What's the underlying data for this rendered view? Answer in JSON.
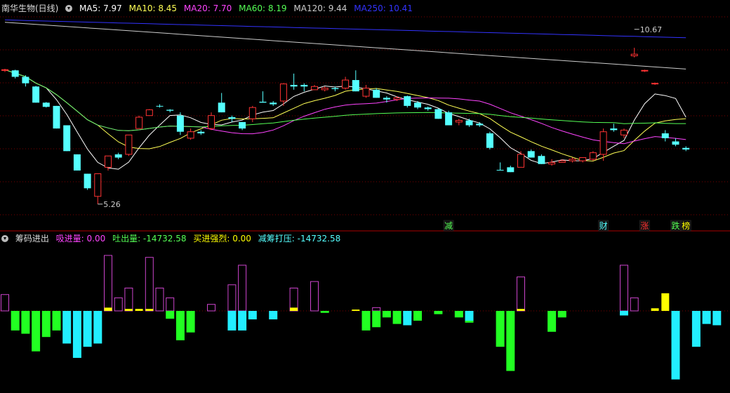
{
  "main_header": {
    "title": "南华生物(日线)",
    "ma": [
      {
        "label": "MA5: 7.97",
        "color": "#ffffff"
      },
      {
        "label": "MA10: 8.45",
        "color": "#ffff55"
      },
      {
        "label": "MA20: 7.70",
        "color": "#ff44ff"
      },
      {
        "label": "MA60: 8.19",
        "color": "#55ff55"
      },
      {
        "label": "MA120: 9.44",
        "color": "#cccccc"
      },
      {
        "label": "MA250: 10.41",
        "color": "#3333ff"
      }
    ]
  },
  "sub_header": {
    "title": "筹码进出",
    "items": [
      {
        "label": "吸进量: 0.00",
        "color": "#ff44ff"
      },
      {
        "label": "吐出量: -14732.58",
        "color": "#55ff55"
      },
      {
        "label": "买进强烈: 0.00",
        "color": "#ffff00"
      },
      {
        "label": "减筹打压: -14732.58",
        "color": "#55ffff"
      }
    ]
  },
  "colors": {
    "up": "#ff3333",
    "down": "#55ffff",
    "grid": "#7a0000",
    "bar_in": "#cc44cc",
    "bar_out": "#22ff22",
    "bar_strong": "#ffff00",
    "bar_press": "#22eeff"
  },
  "chart_data": [
    {
      "type": "candlestick",
      "y_range": [
        4.8,
        11.1
      ],
      "candles": [
        {
          "o": 9.4,
          "h": 9.45,
          "l": 9.35,
          "c": 9.42,
          "d": "up"
        },
        {
          "o": 9.4,
          "h": 9.42,
          "l": 9.15,
          "c": 9.2,
          "d": "down"
        },
        {
          "o": 9.2,
          "h": 9.25,
          "l": 8.9,
          "c": 9.0,
          "d": "down"
        },
        {
          "o": 8.9,
          "h": 8.92,
          "l": 8.4,
          "c": 8.4,
          "d": "down"
        },
        {
          "o": 8.4,
          "h": 8.42,
          "l": 8.25,
          "c": 8.27,
          "d": "down"
        },
        {
          "o": 8.3,
          "h": 8.3,
          "l": 7.6,
          "c": 7.6,
          "d": "down"
        },
        {
          "o": 7.7,
          "h": 7.7,
          "l": 6.9,
          "c": 6.9,
          "d": "down"
        },
        {
          "o": 6.8,
          "h": 6.8,
          "l": 6.3,
          "c": 6.3,
          "d": "down"
        },
        {
          "o": 6.2,
          "h": 6.2,
          "l": 5.7,
          "c": 5.75,
          "d": "down"
        },
        {
          "o": 5.5,
          "h": 6.2,
          "l": 5.26,
          "c": 6.2,
          "d": "up"
        },
        {
          "o": 6.4,
          "h": 6.75,
          "l": 6.3,
          "c": 6.75,
          "d": "up"
        },
        {
          "o": 6.8,
          "h": 6.85,
          "l": 6.65,
          "c": 6.7,
          "d": "down"
        },
        {
          "o": 6.8,
          "h": 7.4,
          "l": 6.75,
          "c": 7.4,
          "d": "up"
        },
        {
          "o": 7.6,
          "h": 8.0,
          "l": 7.6,
          "c": 7.95,
          "d": "up"
        },
        {
          "o": 8.0,
          "h": 8.2,
          "l": 8.0,
          "c": 8.18,
          "d": "up"
        },
        {
          "o": 8.3,
          "h": 8.35,
          "l": 8.25,
          "c": 8.3,
          "d": "down"
        },
        {
          "o": 8.15,
          "h": 8.2,
          "l": 8.1,
          "c": 8.18,
          "d": "down"
        },
        {
          "o": 8.0,
          "h": 8.1,
          "l": 7.4,
          "c": 7.5,
          "d": "down"
        },
        {
          "o": 7.3,
          "h": 7.6,
          "l": 7.25,
          "c": 7.5,
          "d": "up"
        },
        {
          "o": 7.5,
          "h": 7.55,
          "l": 7.4,
          "c": 7.45,
          "d": "down"
        },
        {
          "o": 7.6,
          "h": 8.1,
          "l": 7.55,
          "c": 8.0,
          "d": "up"
        },
        {
          "o": 8.4,
          "h": 8.7,
          "l": 8.1,
          "c": 8.1,
          "d": "down"
        },
        {
          "o": 7.9,
          "h": 8.0,
          "l": 7.8,
          "c": 7.95,
          "d": "down"
        },
        {
          "o": 7.6,
          "h": 7.8,
          "l": 7.55,
          "c": 7.8,
          "d": "down"
        },
        {
          "o": 7.9,
          "h": 8.3,
          "l": 7.8,
          "c": 8.25,
          "d": "up"
        },
        {
          "o": 8.4,
          "h": 8.75,
          "l": 8.4,
          "c": 8.43,
          "d": "down"
        },
        {
          "o": 8.4,
          "h": 8.45,
          "l": 8.3,
          "c": 8.35,
          "d": "down"
        },
        {
          "o": 8.45,
          "h": 9.0,
          "l": 8.3,
          "c": 8.98,
          "d": "up"
        },
        {
          "o": 8.9,
          "h": 9.3,
          "l": 8.8,
          "c": 8.95,
          "d": "down"
        },
        {
          "o": 8.95,
          "h": 9.0,
          "l": 8.75,
          "c": 8.9,
          "d": "down"
        },
        {
          "o": 8.8,
          "h": 8.95,
          "l": 8.8,
          "c": 8.9,
          "d": "up"
        },
        {
          "o": 8.8,
          "h": 8.9,
          "l": 8.75,
          "c": 8.85,
          "d": "up"
        },
        {
          "o": 8.85,
          "h": 8.9,
          "l": 8.75,
          "c": 8.82,
          "d": "down"
        },
        {
          "o": 8.85,
          "h": 9.2,
          "l": 8.8,
          "c": 9.1,
          "d": "up"
        },
        {
          "o": 9.1,
          "h": 9.4,
          "l": 8.75,
          "c": 8.75,
          "d": "down"
        },
        {
          "o": 8.85,
          "h": 8.95,
          "l": 8.55,
          "c": 8.6,
          "d": "up"
        },
        {
          "o": 8.8,
          "h": 8.85,
          "l": 8.55,
          "c": 8.55,
          "d": "down"
        },
        {
          "o": 8.55,
          "h": 8.6,
          "l": 8.4,
          "c": 8.5,
          "d": "down"
        },
        {
          "o": 8.55,
          "h": 8.6,
          "l": 8.45,
          "c": 8.5,
          "d": "up"
        },
        {
          "o": 8.6,
          "h": 8.62,
          "l": 8.25,
          "c": 8.3,
          "d": "down"
        },
        {
          "o": 8.4,
          "h": 8.45,
          "l": 8.2,
          "c": 8.25,
          "d": "down"
        },
        {
          "o": 8.25,
          "h": 8.28,
          "l": 8.15,
          "c": 8.2,
          "d": "down"
        },
        {
          "o": 8.2,
          "h": 8.22,
          "l": 7.9,
          "c": 7.9,
          "d": "down"
        },
        {
          "o": 8.1,
          "h": 8.15,
          "l": 7.7,
          "c": 7.7,
          "d": "down"
        },
        {
          "o": 7.85,
          "h": 7.9,
          "l": 7.7,
          "c": 7.8,
          "d": "up"
        },
        {
          "o": 7.85,
          "h": 7.9,
          "l": 7.65,
          "c": 7.7,
          "d": "down"
        },
        {
          "o": 7.7,
          "h": 7.8,
          "l": 7.65,
          "c": 7.75,
          "d": "down"
        },
        {
          "o": 7.45,
          "h": 7.5,
          "l": 6.95,
          "c": 7.0,
          "d": "down"
        },
        {
          "o": 6.3,
          "h": 6.55,
          "l": 6.3,
          "c": 6.32,
          "d": "down"
        },
        {
          "o": 6.4,
          "h": 6.45,
          "l": 6.25,
          "c": 6.25,
          "d": "down"
        },
        {
          "o": 6.4,
          "h": 6.9,
          "l": 6.4,
          "c": 6.8,
          "d": "up"
        },
        {
          "o": 6.9,
          "h": 6.95,
          "l": 6.7,
          "c": 6.7,
          "d": "down"
        },
        {
          "o": 6.75,
          "h": 6.8,
          "l": 6.5,
          "c": 6.5,
          "d": "down"
        },
        {
          "o": 6.5,
          "h": 6.65,
          "l": 6.45,
          "c": 6.55,
          "d": "up"
        },
        {
          "o": 6.55,
          "h": 6.65,
          "l": 6.55,
          "c": 6.6,
          "d": "up"
        },
        {
          "o": 6.6,
          "h": 6.7,
          "l": 6.55,
          "c": 6.65,
          "d": "up"
        },
        {
          "o": 6.6,
          "h": 6.7,
          "l": 6.55,
          "c": 6.7,
          "d": "up"
        },
        {
          "o": 6.65,
          "h": 6.9,
          "l": 6.6,
          "c": 6.85,
          "d": "up"
        },
        {
          "o": 6.8,
          "h": 7.6,
          "l": 6.6,
          "c": 7.5,
          "d": "up"
        },
        {
          "o": 7.6,
          "h": 7.75,
          "l": 7.5,
          "c": 7.55,
          "d": "down"
        },
        {
          "o": 7.4,
          "h": 7.6,
          "l": 7.3,
          "c": 7.55,
          "d": "up"
        },
        {
          "o": 9.9,
          "h": 10.1,
          "l": 9.8,
          "c": 9.85,
          "d": "up"
        },
        {
          "o": 9.4,
          "h": 9.42,
          "l": 9.35,
          "c": 9.4,
          "d": "up"
        },
        {
          "o": 9.0,
          "h": 9.02,
          "l": 8.95,
          "c": 9.0,
          "d": "up"
        },
        {
          "o": 7.45,
          "h": 7.55,
          "l": 7.2,
          "c": 7.3,
          "d": "down"
        },
        {
          "o": 7.2,
          "h": 7.3,
          "l": 7.05,
          "c": 7.1,
          "d": "down"
        },
        {
          "o": 7.0,
          "h": 7.05,
          "l": 6.9,
          "c": 6.95,
          "d": "down"
        }
      ],
      "annotations": [
        {
          "text": "5.26",
          "candle": 9,
          "price": 5.26
        },
        {
          "text": "10.67",
          "candle": 61,
          "price": 10.67
        }
      ],
      "markers": [
        {
          "text": "减",
          "color": "#55ff55",
          "candle": 43
        },
        {
          "text": "财",
          "color": "#55ffff",
          "candle": 58
        },
        {
          "text": "涨",
          "color": "#ff3333",
          "candle": 62
        },
        {
          "text": "跌",
          "color": "#55ff55",
          "candle": 65
        },
        {
          "text": "榜",
          "color": "#ffff00",
          "candle": 66
        }
      ]
    },
    {
      "type": "bar",
      "series": [
        {
          "name": "吸进量",
          "values": [
            25,
            0,
            0,
            0,
            0,
            0,
            0,
            0,
            0,
            0,
            85,
            20,
            35,
            0,
            82,
            35,
            20,
            0,
            0,
            0,
            10,
            0,
            40,
            70,
            0,
            0,
            0,
            0,
            35,
            0,
            45,
            0,
            0,
            0,
            0,
            0,
            5,
            0,
            0,
            0,
            0,
            0,
            0,
            0,
            0,
            0,
            0,
            0,
            0,
            0,
            52,
            0,
            0,
            0,
            0,
            0,
            0,
            0,
            0,
            0,
            70,
            20,
            0,
            0,
            0,
            0,
            0,
            0,
            0,
            0,
            0
          ]
        },
        {
          "name": "吐出量",
          "values": [
            0,
            -30,
            -35,
            -62,
            -40,
            -30,
            0,
            0,
            0,
            0,
            0,
            0,
            0,
            0,
            0,
            0,
            -12,
            -45,
            -33,
            0,
            0,
            0,
            0,
            0,
            0,
            0,
            0,
            0,
            0,
            0,
            0,
            -3,
            0,
            0,
            0,
            -30,
            -25,
            -10,
            -20,
            -8,
            -15,
            0,
            -5,
            0,
            -10,
            -18,
            0,
            0,
            -55,
            -92,
            0,
            0,
            0,
            -32,
            -10,
            0,
            0,
            0,
            0,
            0,
            0,
            0,
            0,
            0,
            0,
            -80,
            0,
            0,
            0,
            0,
            0
          ]
        },
        {
          "name": "买进强烈",
          "values": [
            0,
            0,
            0,
            0,
            0,
            0,
            0,
            0,
            0,
            0,
            5,
            0,
            3,
            3,
            3,
            0,
            0,
            0,
            0,
            0,
            0,
            0,
            0,
            0,
            0,
            0,
            0,
            0,
            5,
            0,
            0,
            0,
            0,
            0,
            2,
            0,
            0,
            0,
            0,
            0,
            0,
            0,
            0,
            0,
            0,
            0,
            0,
            0,
            0,
            0,
            3,
            0,
            0,
            0,
            0,
            0,
            0,
            0,
            0,
            0,
            0,
            0,
            0,
            4,
            27,
            0,
            0,
            0,
            0,
            0,
            0
          ]
        },
        {
          "name": "减筹打压",
          "values": [
            0,
            0,
            0,
            0,
            0,
            0,
            -50,
            -72,
            -55,
            -50,
            0,
            0,
            0,
            0,
            0,
            0,
            0,
            0,
            0,
            0,
            0,
            0,
            -30,
            -30,
            -13,
            0,
            -13,
            0,
            0,
            0,
            0,
            0,
            0,
            0,
            0,
            0,
            0,
            0,
            0,
            -22,
            0,
            0,
            0,
            0,
            0,
            -15,
            0,
            0,
            0,
            0,
            0,
            0,
            0,
            0,
            0,
            0,
            0,
            0,
            0,
            0,
            -7,
            0,
            0,
            0,
            0,
            -105,
            0,
            -55,
            -20,
            -22,
            0
          ]
        }
      ]
    }
  ]
}
